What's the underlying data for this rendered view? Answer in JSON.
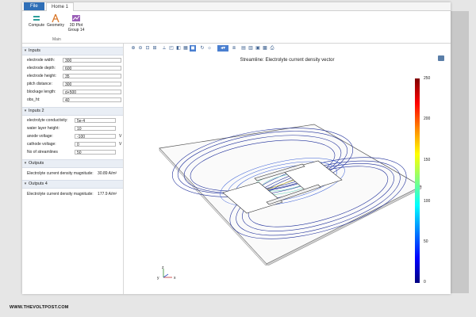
{
  "ribbon": {
    "file_tab": "File",
    "home_tab": "Home 1",
    "compute": "Compute",
    "geometry": "Geometry",
    "plot_group_line1": "3D Plot",
    "plot_group_line2": "Group 14",
    "group_label": "Main"
  },
  "inputs": {
    "title": "Inputs",
    "fields": [
      {
        "label": "electrode width:",
        "value": "300"
      },
      {
        "label": "electrode depth:",
        "value": "600"
      },
      {
        "label": "electrode height:",
        "value": "35"
      },
      {
        "label": "pitch distance:",
        "value": "300"
      },
      {
        "label": "blockage length:",
        "value": "d+500"
      },
      {
        "label": "obs_ht:",
        "value": "40"
      }
    ]
  },
  "inputs2": {
    "title": "Inputs 2",
    "fields": [
      {
        "label": "electrolyte conductivity:",
        "value": "5e-4",
        "unit": ""
      },
      {
        "label": "water layer height:",
        "value": "10",
        "unit": ""
      },
      {
        "label": "anode voltage:",
        "value": "-100",
        "unit": "V"
      },
      {
        "label": "cathode voltage:",
        "value": "0",
        "unit": "V"
      },
      {
        "label": "No of streamlines",
        "value": "50",
        "unit": ""
      }
    ]
  },
  "outputs": {
    "title": "Outputs",
    "label": "Electrolyte current density magnitude:",
    "value": "30.89 A/m²"
  },
  "outputs4": {
    "title": "Outputs 4",
    "label": "Electrolyte current density magnitude:",
    "value": "177.9 A/m²"
  },
  "plot": {
    "title": "Streamline: Electrolyte current density vector",
    "colorbar_ticks": [
      "250",
      "200",
      "150",
      "100",
      "50",
      "0"
    ],
    "axis_labels": {
      "x": "x",
      "y": "y",
      "z": "z"
    }
  },
  "footer": "WWW.THEVOLTPOST.COM",
  "colors": {
    "file_tab": "#2f6fb7",
    "section_bg": "#e9eef5",
    "streamline_outer": "#1f2f9a",
    "streamline_inner": "#3a5fd6",
    "streamline_center": "#e0d04a"
  }
}
